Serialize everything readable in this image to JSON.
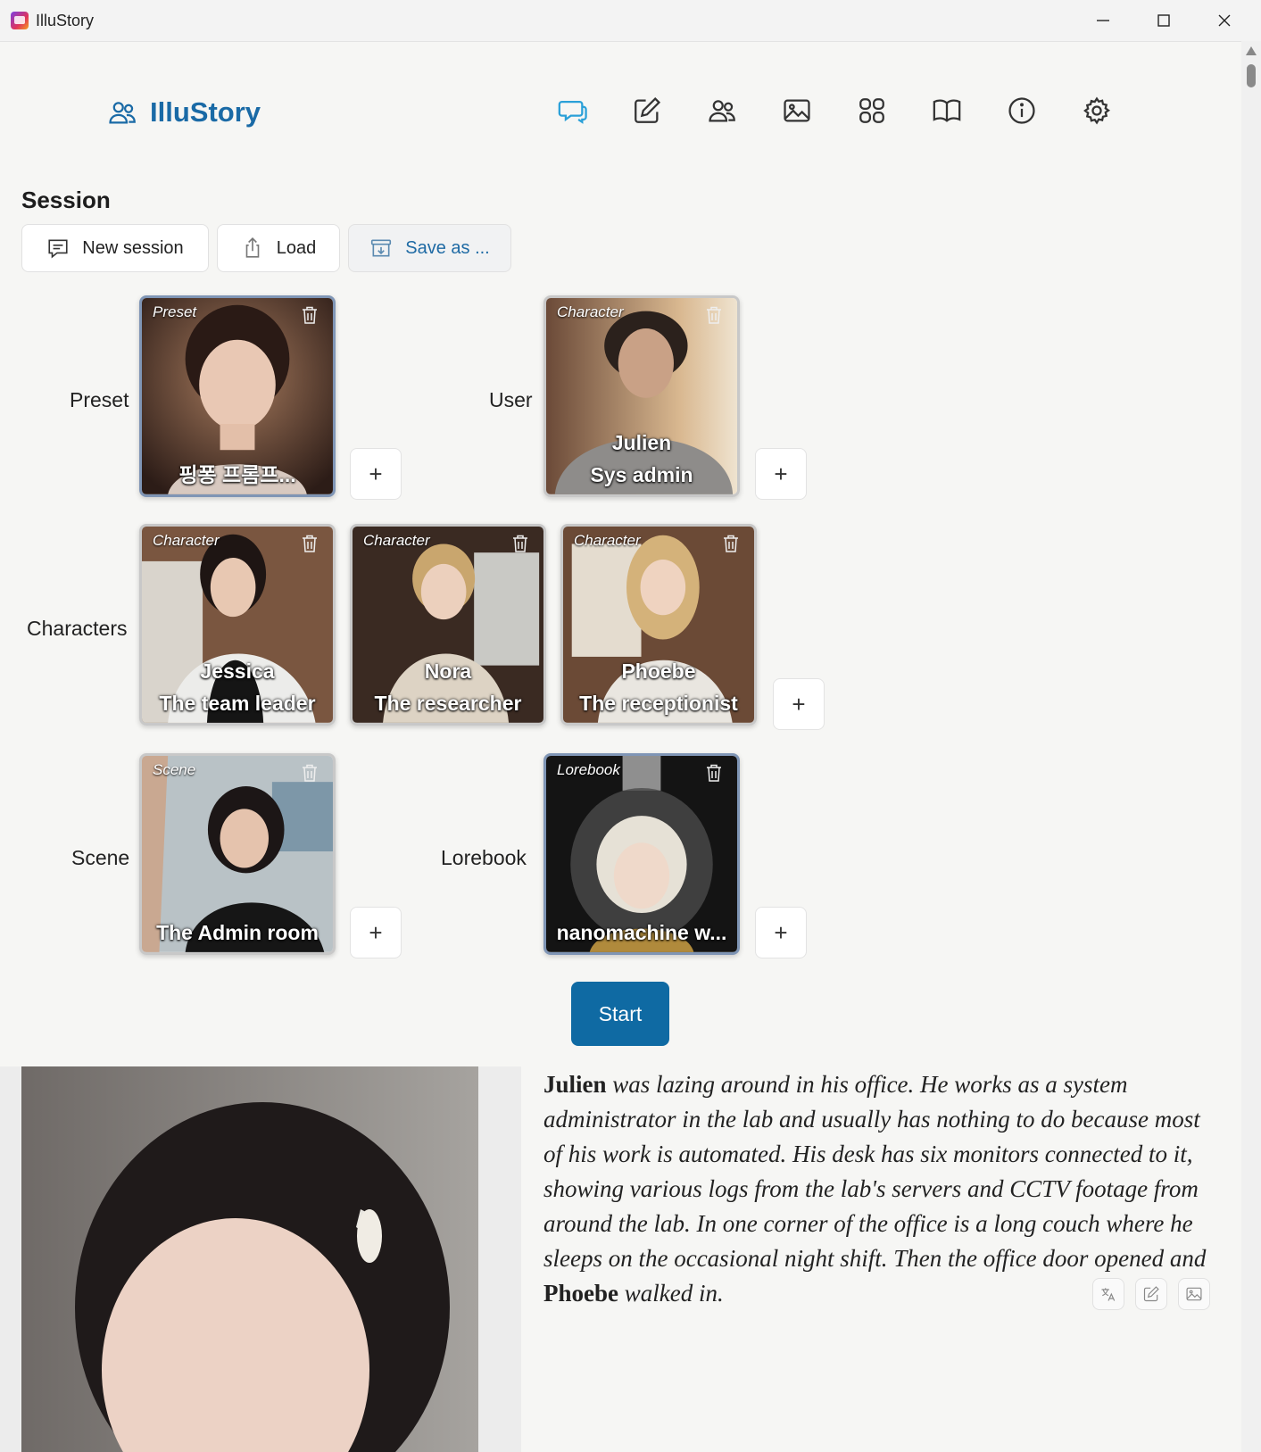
{
  "window": {
    "title": "IlluStory"
  },
  "brand": {
    "name": "IlluStory"
  },
  "nav": [
    "chat-icon",
    "edit-icon",
    "users-icon",
    "image-icon",
    "grid-icon",
    "book-icon",
    "info-icon",
    "settings-icon"
  ],
  "session": {
    "title": "Session",
    "new_label": "New session",
    "load_label": "Load",
    "save_label": "Save as ..."
  },
  "rows": {
    "preset": "Preset",
    "user": "User",
    "characters": "Characters",
    "scene": "Scene",
    "lorebook": "Lorebook"
  },
  "cards": {
    "preset": {
      "tag": "Preset",
      "name": "핑퐁 프롬프...",
      "sub": ""
    },
    "user": {
      "tag": "Character",
      "name": "Julien",
      "sub": "Sys admin"
    },
    "jessica": {
      "tag": "Character",
      "name": "Jessica",
      "sub": "The team leader"
    },
    "nora": {
      "tag": "Character",
      "name": "Nora",
      "sub": "The researcher"
    },
    "phoebe": {
      "tag": "Character",
      "name": "Phoebe",
      "sub": "The receptionist"
    },
    "scene": {
      "tag": "Scene",
      "name": "The Admin room"
    },
    "lorebook": {
      "tag": "Lorebook",
      "name": "nanomachine w..."
    }
  },
  "plus_label": "+",
  "start_label": "Start",
  "story": {
    "name1": "Julien",
    "text1": " was lazing around in his office. He works as a system administrator in the lab and usually has nothing to do because most of his work is automated. His desk has six monitors connected to it, showing various logs from the lab's servers and CCTV footage from around the lab. In one corner of the office is a long couch where he sleeps on the occasional night shift. Then the office door opened and ",
    "name2": "Phoebe",
    "text2": " walked in."
  },
  "colors": {
    "accent": "#1a6aa6",
    "start_button": "#0f6aa3"
  }
}
